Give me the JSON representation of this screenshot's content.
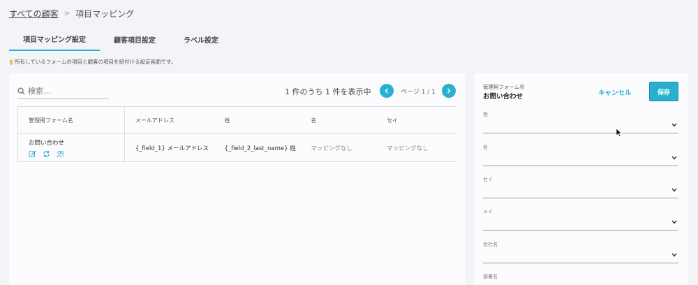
{
  "breadcrumb": {
    "root": "すべての顧客",
    "separator": ">",
    "current": "項目マッピング"
  },
  "tabs": [
    {
      "label": "項目マッピング設定",
      "active": true
    },
    {
      "label": "顧客項目設定",
      "active": false
    },
    {
      "label": "ラベル設定",
      "active": false
    }
  ],
  "hint": "所有しているフォームの項目と顧客の項目を紐付ける設定画面です。",
  "search": {
    "placeholder": "検索…",
    "icon": "search-icon"
  },
  "pager": {
    "count_text": "1 件のうち 1 件を表示中",
    "page_text": "ページ 1 / 1"
  },
  "table": {
    "headers": [
      "管理用フォーム名",
      "メールアドレス",
      "姓",
      "名",
      "セイ"
    ],
    "rows": [
      {
        "form_name": "お問い合わせ",
        "email": "{_field_1} メールアドレス",
        "last_name": "{_field_2_last_name} 姓",
        "first_name": "マッピングなし",
        "sei": "マッピングなし"
      }
    ]
  },
  "side": {
    "form_label": "管理用フォーム名",
    "form_name": "お問い合わせ",
    "cancel_label": "キャンセル",
    "save_label": "保存",
    "fields": [
      "姓",
      "名",
      "セイ",
      "メイ",
      "会社名",
      "部署名"
    ]
  },
  "colors": {
    "accent": "#2ab0cf",
    "background": "#f3f4f8",
    "panel": "#fcfcfe"
  }
}
